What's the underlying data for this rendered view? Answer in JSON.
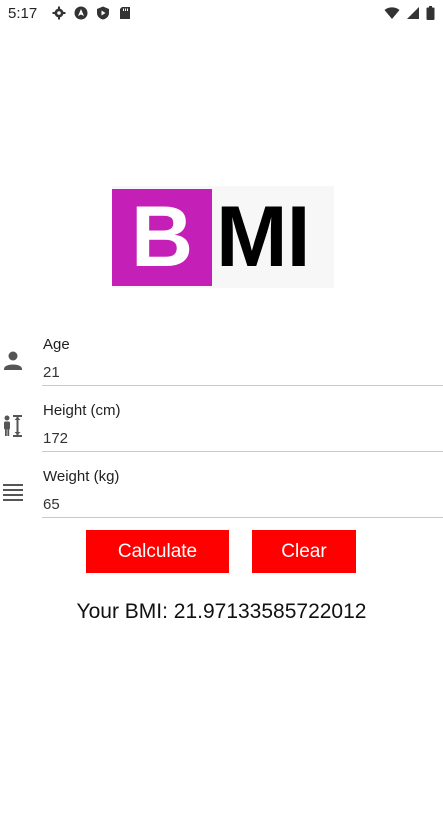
{
  "status_bar": {
    "time": "5:17",
    "left_icons": [
      "settings-icon",
      "android-auto-icon",
      "play-protect-icon",
      "sd-card-icon"
    ],
    "right_icons": [
      "wifi-icon",
      "cell-signal-icon",
      "battery-icon"
    ]
  },
  "logo": {
    "letter_b": "B",
    "letters_mi": "MI",
    "colors": {
      "b_background": "#c41fb6",
      "mi_text": "#000000"
    }
  },
  "form": {
    "age": {
      "label": "Age",
      "value": "21",
      "icon": "person-icon"
    },
    "height": {
      "label": "Height (cm)",
      "value": "172",
      "icon": "height-icon"
    },
    "weight": {
      "label": "Weight (kg)",
      "value": "65",
      "icon": "weight-icon"
    }
  },
  "buttons": {
    "calculate_label": "Calculate",
    "clear_label": "Clear",
    "color": "#ff0000"
  },
  "result": {
    "text": "Your BMI: 21.97133585722012"
  }
}
